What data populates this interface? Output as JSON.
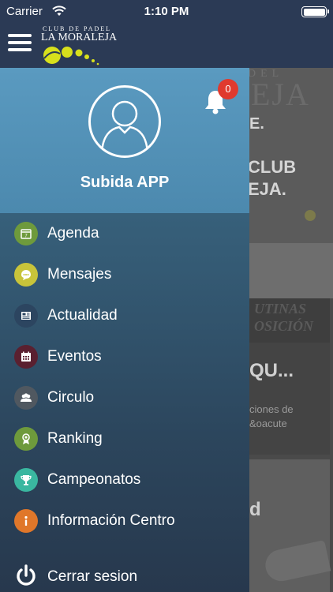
{
  "status_bar": {
    "carrier": "Carrier",
    "time": "1:10 PM"
  },
  "header": {
    "menu_icon": "hamburger-icon",
    "logo": {
      "small_text": "CLUB DE PADEL",
      "main_text": "LA MORALEJA"
    }
  },
  "drawer": {
    "user": {
      "name": "Subida APP",
      "avatar_icon": "user-avatar-icon"
    },
    "notifications": {
      "icon": "bell-icon",
      "count": "0"
    },
    "items": [
      {
        "label": "Agenda",
        "icon": "calendar-icon",
        "color": "#6e9a3c"
      },
      {
        "label": "Mensajes",
        "icon": "chat-icon",
        "color": "#c8c43a"
      },
      {
        "label": "Actualidad",
        "icon": "newspaper-icon",
        "color": "#2c4560"
      },
      {
        "label": "Eventos",
        "icon": "event-calendar-icon",
        "color": "#5a2030"
      },
      {
        "label": "Circulo",
        "icon": "group-icon",
        "color": "#505860"
      },
      {
        "label": "Ranking",
        "icon": "medal-icon",
        "color": "#6e9a3c"
      },
      {
        "label": "Campeonatos",
        "icon": "trophy-icon",
        "color": "#3ab7a0"
      },
      {
        "label": "Información Centro",
        "icon": "info-icon",
        "color": "#e0772a"
      }
    ],
    "logout": {
      "label": "Cerrar sesion",
      "icon": "power-icon"
    }
  },
  "background": {
    "hero_logo": "DEL",
    "hero_logo_big": "EJA",
    "hero_e": "E.",
    "hero_club_line1": "CLUB",
    "hero_club_line2": "EJA.",
    "card1_overlay_line1": "UTINAS",
    "card1_overlay_line2": "OSICIÓN",
    "card1_title": "QU...",
    "card1_text_line1": "ciones de",
    "card1_text_line2": "&oacute",
    "card2_title": "d"
  }
}
